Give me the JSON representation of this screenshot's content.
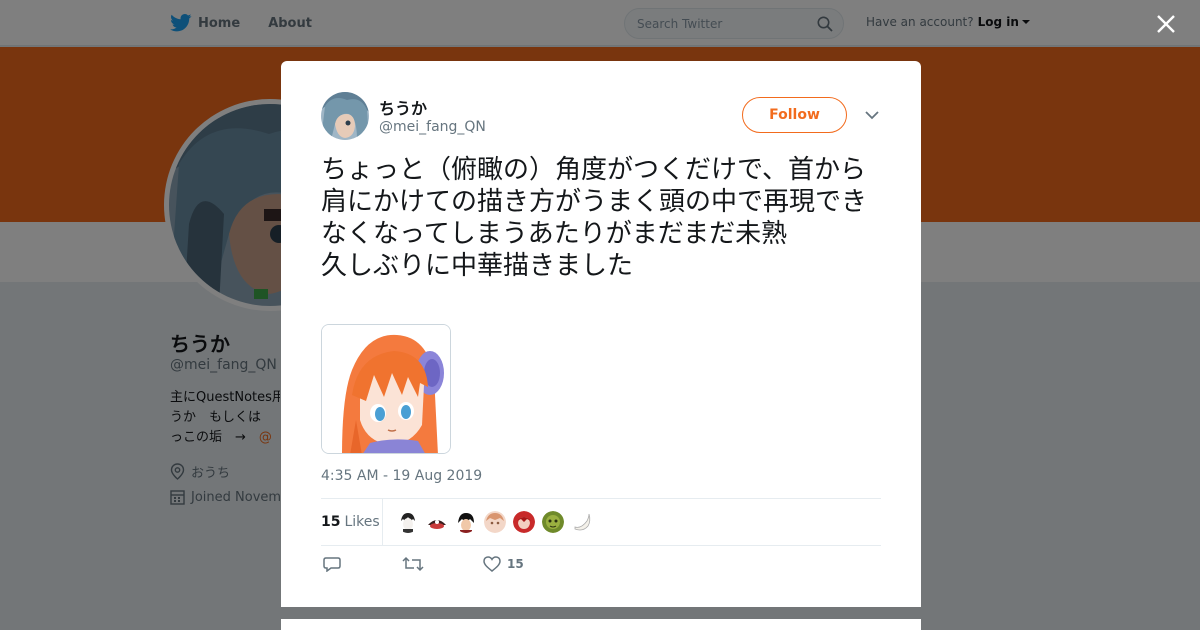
{
  "nav": {
    "home_label": "Home",
    "about_label": "About",
    "search_placeholder": "Search Twitter",
    "have_account": "Have an account?",
    "login_label": "Log in"
  },
  "profile": {
    "name": "ちうか",
    "handle": "@mei_fang_QN",
    "bio_line1": "主にQuestNotes用",
    "bio_line2": "うか　もしくは",
    "bio_line3": "っこの垢　→　",
    "bio_link": "@",
    "location": "おうち",
    "joined": "Joined Novem"
  },
  "colors": {
    "accent": "#f26b1d",
    "background": "#e6ecf0"
  },
  "tweet": {
    "name": "ちうか",
    "handle": "@mei_fang_QN",
    "follow_label": "Follow",
    "text": "ちょっと（俯瞰の）角度がつくだけで、首から肩にかけての描き方がうまく頭の中で再現できなくなってしまうあたりがまだまだ未熟\n久しぶりに中華描きました",
    "timestamp": "4:35 AM - 19 Aug 2019",
    "likes_count": "15",
    "likes_label": "Likes",
    "like_action_count": "15",
    "liker_icons": [
      "liker-1",
      "liker-2",
      "liker-3",
      "liker-4",
      "liker-5",
      "liker-6",
      "liker-7"
    ]
  },
  "icons": {
    "bird": "twitter-bird-icon",
    "search": "search-icon",
    "close": "close-icon",
    "reply": "reply-icon",
    "retweet": "retweet-icon",
    "like": "heart-icon",
    "location": "location-pin-icon",
    "calendar": "calendar-icon",
    "menu": "chevron-down-icon"
  }
}
